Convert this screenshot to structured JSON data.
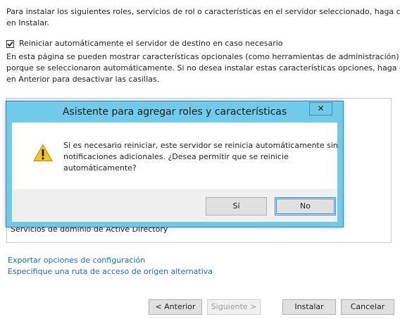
{
  "intro": {
    "line1": "Para instalar los siguientes roles, servicios de rol o características en el servidor seleccionado, haga clic",
    "line2": "en Instalar."
  },
  "restart_checkbox": {
    "label": "Reiniciar automáticamente el servidor de destino en caso necesario",
    "checked": true
  },
  "optional_info": {
    "line1": "En esta página se pueden mostrar características opcionales (como herramientas de administración)",
    "line2": "porque se seleccionaron automáticamente. Si no desea instalar estas características opciones, haga clic",
    "line3": "en Anterior para desactivar las casillas."
  },
  "feature_list": {
    "visible_item": "Servicios de dominio de Active Directory"
  },
  "links": {
    "export": "Exportar opciones de configuración",
    "alt_source": "Especifique una ruta de acceso de origen alternativa"
  },
  "footer_buttons": {
    "previous": "< Anterior",
    "next": "Siguiente >",
    "install": "Instalar",
    "cancel": "Cancelar"
  },
  "dialog": {
    "title": "Asistente para agregar roles y características",
    "close_glyph": "✕",
    "icon": "warning-icon",
    "message_line1": "Si es necesario reiniciar, este servidor se reinicia automáticamente sin",
    "message_line2": "notificaciones adicionales. ¿Desea permitir que se reinicie",
    "message_line3": "automáticamente?",
    "yes": "Sí",
    "no": "No"
  },
  "colors": {
    "dialog_frame": "#6fcbe9",
    "link": "#1a6ea8",
    "warning_fill": "#f5c518"
  }
}
